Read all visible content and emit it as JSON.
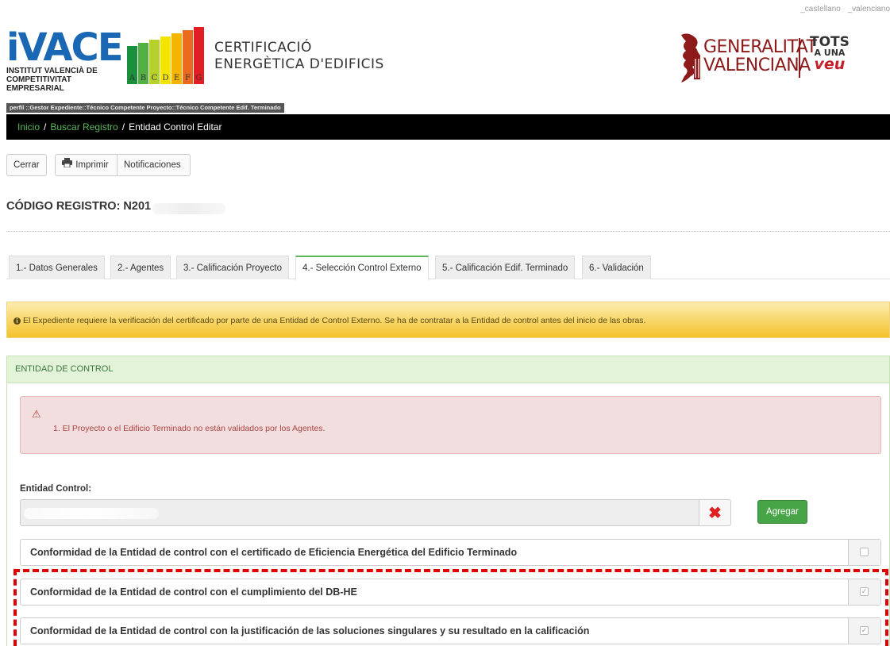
{
  "header": {
    "lang": {
      "castellano": "_castellano",
      "valenciano": "_valenciano"
    },
    "ivace": {
      "mark": "iVACE",
      "subtitle_line1": "INSTITUT VALENCIÀ DE",
      "subtitle_line2": "COMPETITIVITAT EMPRESARIAL"
    },
    "energy_letters": [
      "A",
      "B",
      "C",
      "D",
      "E",
      "F",
      "G"
    ],
    "energy_colors": [
      "#1a8f3c",
      "#52b044",
      "#b6d12b",
      "#f3e500",
      "#f4b400",
      "#ea6a1f",
      "#e21d24"
    ],
    "cert_title_line1": "CERTIFICACIÓ",
    "cert_title_line2": "ENERGÈTICA D'EDIFICIS",
    "gv_line1": "GENERALITAT",
    "gv_line2": "VALENCIANA",
    "tots_line1": "TOTS",
    "tots_line2": "A UNA",
    "tots_line3": "veu"
  },
  "perfil": "perfil ::Gestor Expediente::Técnico Competente Proyecto::Técnico Competente Edif. Terminado",
  "breadcrumb": {
    "inicio": "Inicio",
    "buscar": "Buscar Registro",
    "current": "Entidad Control Editar",
    "separator": "/"
  },
  "toolbar": {
    "cerrar": "Cerrar",
    "imprimir": "Imprimir",
    "notificaciones": "Notificaciones"
  },
  "codigo_registro": "CÓDIGO REGISTRO: N201",
  "tabs": [
    {
      "label": "1.- Datos Generales"
    },
    {
      "label": "2.- Agentes"
    },
    {
      "label": "3.- Calificación Proyecto"
    },
    {
      "label": "4.- Selección Control Externo"
    },
    {
      "label": "5.- Calificación Edif. Terminado"
    },
    {
      "label": "6.- Validación"
    }
  ],
  "active_tab": "4.- Selección Control Externo",
  "alert_text": "El Expediente requiere la verificación del certificado por parte de una Entidad de Control Externo. Se ha de contratar a la Entidad de control antes del inicio de las obras.",
  "panel": {
    "title": "ENTIDAD DE CONTROL",
    "error_message": "1. El Proyecto o el Edificio Terminado no están validados por los Agentes.",
    "entidad_label": "Entidad Control:",
    "agregar": "Agregar",
    "conformidades": [
      {
        "label": "Conformidad de la Entidad de control con el certificado de Eficiencia Energética del Edificio Terminado",
        "checked": false
      },
      {
        "label": "Conformidad de la Entidad de control con el cumplimiento del DB-HE",
        "checked": true
      },
      {
        "label": "Conformidad de la Entidad de control con la justificación de las soluciones singulares y su resultado en la calificación",
        "checked": true
      }
    ]
  },
  "colors": {
    "link_green": "#5cb85c",
    "alert_yellow": "#f4c22b",
    "danger_red": "#a94442",
    "highlight_red": "#e00000"
  }
}
